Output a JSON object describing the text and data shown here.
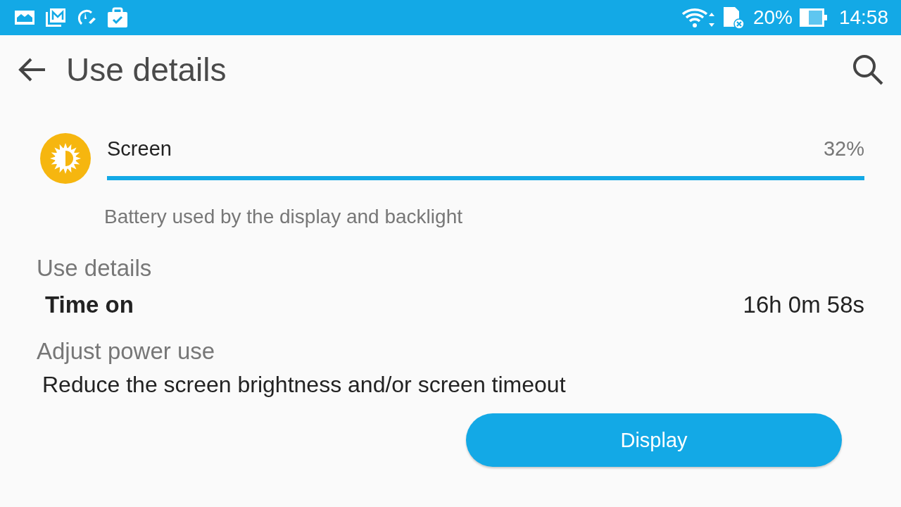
{
  "status_bar": {
    "battery": "20%",
    "time": "14:58"
  },
  "app_bar": {
    "title": "Use details"
  },
  "usage": {
    "name": "Screen",
    "percent": "32%",
    "level": 1,
    "description": "Battery used by the display and backlight"
  },
  "sections": [
    {
      "kind": "detail",
      "header": "Use details",
      "label": "Time on",
      "value": "16h 0m 58s"
    },
    {
      "kind": "action",
      "header": "Adjust power use",
      "text": "Reduce the screen brightness and/or screen timeout",
      "button": "Display"
    }
  ]
}
